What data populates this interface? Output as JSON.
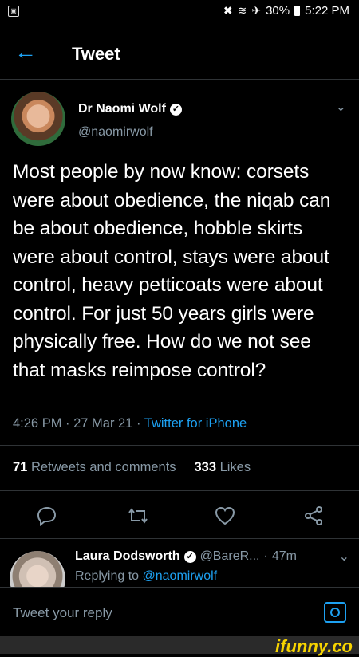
{
  "status_bar": {
    "battery": "30%",
    "time": "5:22 PM"
  },
  "header": {
    "title": "Tweet"
  },
  "tweet": {
    "author_name": "Dr Naomi Wolf",
    "author_handle": "@naomirwolf",
    "text": "Most people by now know: corsets were about obedience, the niqab can be about obedience, hobble skirts were about control, stays were about control, heavy petticoats were about control. For just 50 years girls were physically free. How do we not see that masks reimpose control?",
    "time": "4:26 PM",
    "date": "27 Mar 21",
    "source": "Twitter for iPhone",
    "retweets_count": "71",
    "retweets_label": "Retweets and comments",
    "likes_count": "333",
    "likes_label": "Likes"
  },
  "reply": {
    "name": "Laura Dodsworth",
    "handle": "@BareR...",
    "age": "47m",
    "replying_prefix": "Replying to",
    "replying_handle": "@naomirwolf"
  },
  "composer": {
    "placeholder": "Tweet your reply"
  },
  "watermark": "ifunny.co",
  "colors": {
    "accent": "#1da1f2",
    "muted": "#8899a6",
    "background": "#000000"
  }
}
